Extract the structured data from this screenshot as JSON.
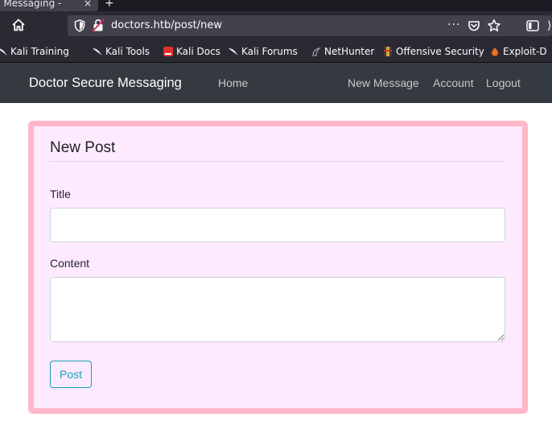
{
  "browser": {
    "tab_title": "c Messaging - ",
    "tab_close": "×",
    "new_tab": "+",
    "url": "doctors.htb/post/new",
    "meatball": "···",
    "overflow": "⟩"
  },
  "bookmarks": [
    {
      "label": "Kali Training"
    },
    {
      "label": "Kali Tools"
    },
    {
      "label": "Kali Docs"
    },
    {
      "label": "Kali Forums"
    },
    {
      "label": "NetHunter"
    },
    {
      "label": "Offensive Security"
    },
    {
      "label": "Exploit-D"
    }
  ],
  "site": {
    "brand": "Doctor Secure Messaging",
    "nav_left": [
      "Home"
    ],
    "nav_right": [
      "New Message",
      "Account",
      "Logout"
    ]
  },
  "form": {
    "legend": "New Post",
    "title_label": "Title",
    "title_value": "",
    "content_label": "Content",
    "content_value": "",
    "submit_label": "Post"
  },
  "colors": {
    "card_bg": "#fdeaff",
    "card_border": "#ffb6c9",
    "navbar_bg": "#343a40",
    "button_accent": "#17a2b8"
  }
}
